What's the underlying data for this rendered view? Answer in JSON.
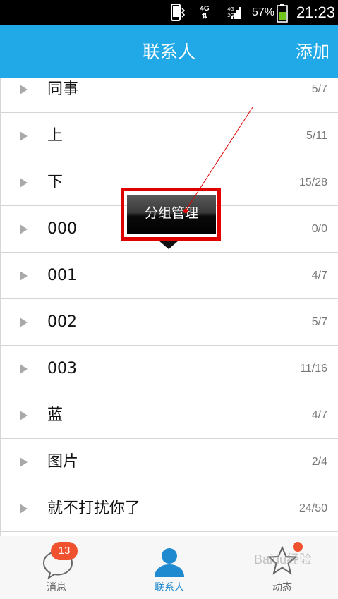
{
  "status_bar": {
    "network_primary": "4G",
    "network_secondary": [
      "4G",
      "2G"
    ],
    "battery_percent": "57%",
    "time": "21:23",
    "icons": [
      "phone-vibrate-icon",
      "signal-icon",
      "battery-icon"
    ]
  },
  "header": {
    "title": "联系人",
    "add_label": "添加"
  },
  "groups": [
    {
      "name": "同事",
      "count": "5/7"
    },
    {
      "name": "上",
      "count": "5/11"
    },
    {
      "name": "下",
      "count": "15/28"
    },
    {
      "name": "000",
      "count": "0/0"
    },
    {
      "name": "001",
      "count": "4/7"
    },
    {
      "name": "002",
      "count": "5/7"
    },
    {
      "name": "003",
      "count": "11/16"
    },
    {
      "name": "蓝",
      "count": "4/7"
    },
    {
      "name": "图片",
      "count": "2/4"
    },
    {
      "name": "就不打扰你了",
      "count": "24/50"
    }
  ],
  "popup": {
    "label": "分组管理"
  },
  "tabbar": {
    "tabs": [
      {
        "label": "消息",
        "badge": "13"
      },
      {
        "label": "联系人",
        "active": true
      },
      {
        "label": "动态"
      }
    ]
  },
  "watermark": "Baidu经验",
  "colors": {
    "header": "#20a9e6",
    "highlight_frame": "#e00000",
    "badge": "#f0512f",
    "active_tab": "#1f8ad0"
  }
}
